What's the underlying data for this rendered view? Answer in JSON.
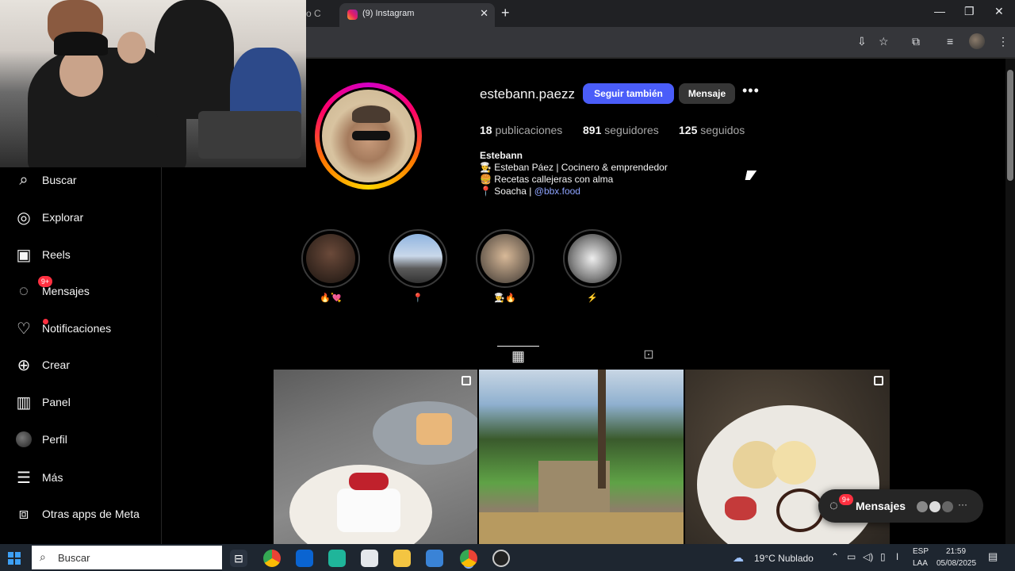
{
  "browser": {
    "prev_tab_label": "o C",
    "active_tab_title": "(9) Instagram",
    "new_tab": "+",
    "window_controls": [
      "—",
      "❐",
      "✕"
    ]
  },
  "sidebar": {
    "items": [
      {
        "label": "Buscar",
        "icon": "search-icon"
      },
      {
        "label": "Explorar",
        "icon": "compass-icon"
      },
      {
        "label": "Reels",
        "icon": "reels-icon"
      },
      {
        "label": "Mensajes",
        "icon": "messenger-icon",
        "badge": "9+"
      },
      {
        "label": "Notificaciones",
        "icon": "heart-icon"
      },
      {
        "label": "Crear",
        "icon": "plus-square-icon"
      },
      {
        "label": "Panel",
        "icon": "chart-icon"
      },
      {
        "label": "Perfil",
        "icon": "avatar-icon"
      },
      {
        "label": "Más",
        "icon": "menu-icon"
      },
      {
        "label": "Otras apps de Meta",
        "icon": "apps-icon"
      }
    ]
  },
  "profile": {
    "username": "estebann.paezz",
    "follow_button": "Seguir también",
    "message_button": "Mensaje",
    "more": "•••",
    "stats": {
      "posts_count": "18",
      "posts_label": "publicaciones",
      "followers_count": "891",
      "followers_label": "seguidores",
      "following_count": "125",
      "following_label": "seguidos"
    },
    "bio_name": "Estebann",
    "bio_lines": [
      "👨‍🍳 Esteban Páez | Cocinero & emprendedor",
      "🍔 Recetas callejeras con alma",
      "📍 Soacha | "
    ],
    "bio_link": "@bbx.food"
  },
  "highlights": [
    {
      "label": "🔥💘"
    },
    {
      "label": "📍"
    },
    {
      "label": "👨‍🍳🔥"
    },
    {
      "label": "⚡"
    }
  ],
  "tabs": {
    "grid_icon": "▦",
    "tagged_icon": "⊡"
  },
  "messages_pill": {
    "label": "Mensajes",
    "badge": "9+",
    "more": "···"
  },
  "taskbar": {
    "search_placeholder": "Buscar",
    "weather": "19°C  Nublado",
    "lang_top": "ESP",
    "lang_bottom": "LAA",
    "time": "21:59",
    "date": "05/08/2025"
  },
  "colors": {
    "follow_button": "#4a5df9",
    "badge": "#ff3040",
    "link": "#8ea4ff"
  }
}
